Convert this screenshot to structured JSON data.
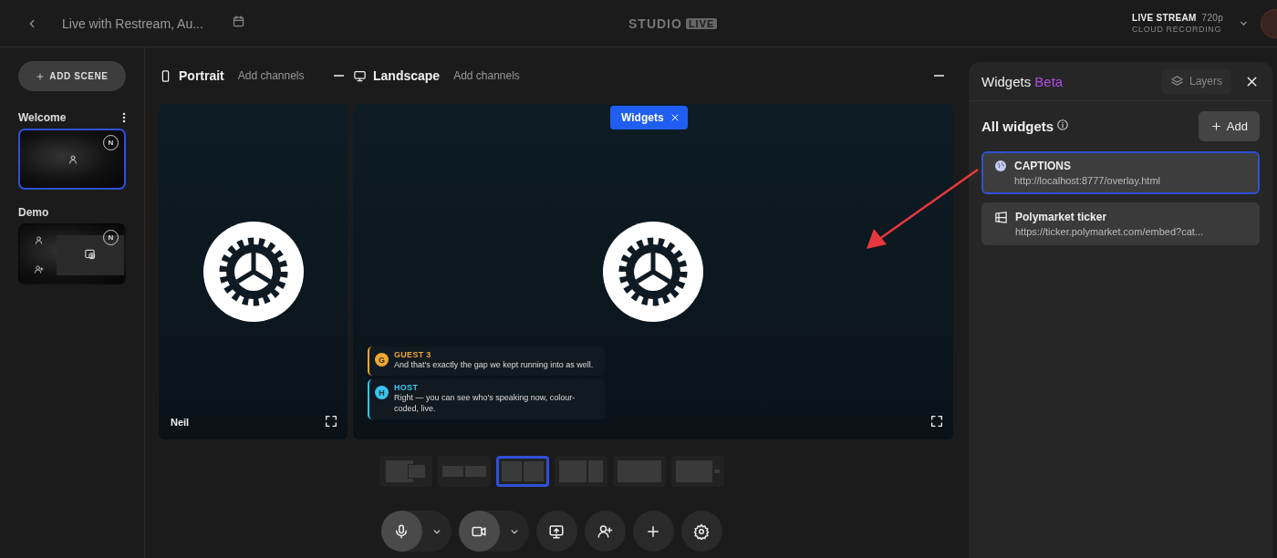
{
  "top_bar": {
    "title": "Live with Restream, Au...",
    "logo_text": "STUDIO",
    "logo_badge": "LIVE",
    "stream_label": "LIVE STREAM",
    "resolution": "720p",
    "recording": "CLOUD RECORDING"
  },
  "sidebar": {
    "add_button": "ADD SCENE",
    "scenes": [
      {
        "name": "Welcome",
        "selected": true,
        "kind": "single",
        "badge": "N"
      },
      {
        "name": "Demo",
        "selected": false,
        "kind": "grid",
        "badge": "N"
      }
    ]
  },
  "canvases": [
    {
      "kind": "portrait",
      "title": "Portrait",
      "link": "Add channels"
    },
    {
      "kind": "landscape",
      "title": "Landscape",
      "link": "Add channels"
    }
  ],
  "stage": {
    "widgets_chip": "Widgets",
    "portrait_name": "Neil",
    "captions": [
      {
        "speaker": "GUEST 3",
        "initial": "G",
        "text": "And that's exactly the gap we kept running into as well.",
        "color": "#f0a830"
      },
      {
        "speaker": "HOST",
        "initial": "H",
        "text": "Right — you can see who's speaking now, colour-coded, live.",
        "color": "#38c4ee"
      }
    ]
  },
  "layouts": [
    {
      "kind": "pip",
      "selected": false
    },
    {
      "kind": "row",
      "selected": false
    },
    {
      "kind": "split",
      "selected": true
    },
    {
      "kind": "wide-split",
      "selected": false
    },
    {
      "kind": "corner",
      "selected": false
    },
    {
      "kind": "side",
      "selected": false
    }
  ],
  "controls": [
    {
      "kind": "mic",
      "dropdown": true
    },
    {
      "kind": "camera",
      "dropdown": true
    },
    {
      "kind": "share",
      "dropdown": false
    },
    {
      "kind": "invite",
      "dropdown": false
    },
    {
      "kind": "plus",
      "dropdown": false
    },
    {
      "kind": "settings",
      "dropdown": false
    }
  ],
  "widgets_panel": {
    "title": "Widgets",
    "badge": "Beta",
    "layers": "Layers",
    "heading": "All widgets",
    "add": "Add",
    "widgets": [
      {
        "kind": "globe",
        "name": "CAPTIONS",
        "url": "http://localhost:8777/overlay.html",
        "selected": true
      },
      {
        "kind": "frame",
        "name": "Polymarket ticker",
        "url": "https://ticker.polymarket.com/embed?cat...",
        "selected": false
      }
    ]
  }
}
